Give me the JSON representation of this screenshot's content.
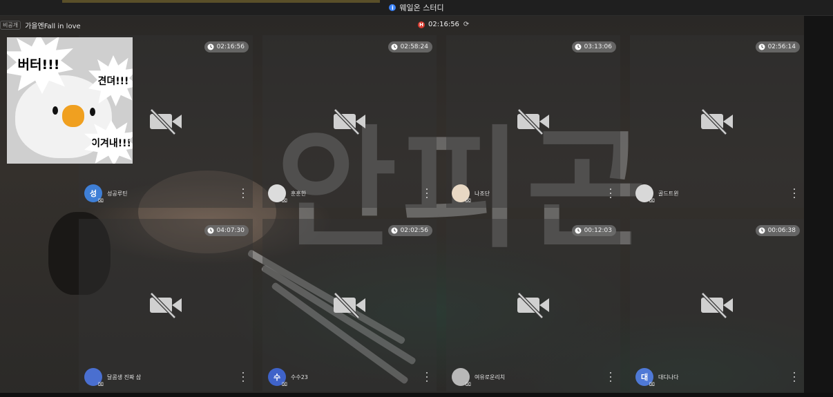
{
  "window": {
    "title": "웨일온 스터디"
  },
  "room": {
    "privacy": "비공개",
    "title": "가을엔Fall in love",
    "timer": "02:16:56",
    "rec_letter": "H"
  },
  "background_text": "안피곤",
  "sticker": {
    "top": "버터!!!",
    "middle": "견뎌!!!",
    "bottom": "이겨내!!!"
  },
  "participants": [
    {
      "time": "02:16:56",
      "name": "성공루틴",
      "avatar_letter": "성",
      "avatar_color": "#3f7fd6"
    },
    {
      "time": "02:58:24",
      "name": "훈훈한",
      "avatar_letter": "",
      "avatar_color": "#dcdcdc"
    },
    {
      "time": "03:13:06",
      "name": "나조단",
      "avatar_letter": "",
      "avatar_color": "#e8d8c4"
    },
    {
      "time": "02:56:14",
      "name": "골드트윈",
      "avatar_letter": "",
      "avatar_color": "#d8d8d8"
    },
    {
      "time": "04:07:30",
      "name": "달콤생 진짜 삼",
      "avatar_letter": "",
      "avatar_color": "#4a6fd0"
    },
    {
      "time": "02:02:56",
      "name": "수수23",
      "avatar_letter": "수",
      "avatar_color": "#3f63c9"
    },
    {
      "time": "00:12:03",
      "name": "여유로운리치",
      "avatar_letter": "",
      "avatar_color": "#b8b8b8"
    },
    {
      "time": "00:06:38",
      "name": "대디나다",
      "avatar_letter": "대",
      "avatar_color": "#4f79d6"
    }
  ],
  "icons": {
    "camera_off": "camera-off-icon",
    "clock": "clock-icon",
    "more": "more-vertical-icon"
  }
}
